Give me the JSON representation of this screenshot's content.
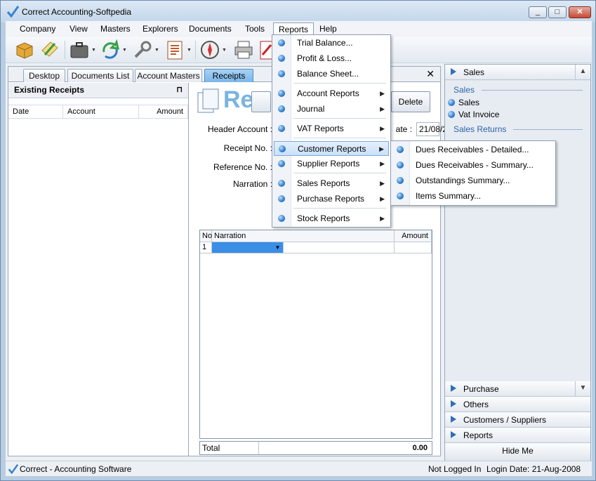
{
  "window": {
    "title": "Correct Accounting-Softpedia",
    "minimize": "_",
    "maximize": "□",
    "close": "✕"
  },
  "menubar": [
    "Company",
    "View",
    "Masters",
    "Explorers",
    "Documents",
    "Tools",
    "Reports",
    "Help"
  ],
  "tabs": {
    "items": [
      "Desktop",
      "Documents List",
      "Account Masters",
      "Receipts"
    ],
    "active": "Receipts",
    "close": "✕"
  },
  "left_pane": {
    "title": "Existing Receipts",
    "pin": "⊓",
    "columns": [
      "Date",
      "Account",
      "Amount"
    ]
  },
  "form": {
    "title": "Re",
    "buttons": {
      "delete": "Delete"
    },
    "labels": {
      "header_account": "Header Account :",
      "receipt_no": "Receipt No. :",
      "reference_no": "Reference No. :",
      "narration": "Narration :",
      "date": "ate :"
    },
    "date_value": "21/08/2",
    "grid": {
      "col_no": "No",
      "col_narration": "Narration",
      "col_amount": "Amount",
      "row1_no": "1"
    },
    "total_label": "Total",
    "total_value": "0.00"
  },
  "right_pane": {
    "top_header": "Sales",
    "section_sales": "Sales",
    "sales_items": [
      "Sales",
      "Vat Invoice"
    ],
    "section_returns": "Sales Returns",
    "bottom_headers": [
      "Purchase",
      "Others",
      "Customers / Suppliers",
      "Reports"
    ],
    "hide": "Hide Me"
  },
  "reports_menu": [
    {
      "label": "Trial Balance...",
      "submenu": false
    },
    {
      "label": "Profit & Loss...",
      "submenu": false
    },
    {
      "label": "Balance Sheet...",
      "submenu": false
    },
    {
      "label": "Account Reports",
      "submenu": true
    },
    {
      "label": "Journal",
      "submenu": true
    },
    {
      "label": "VAT Reports",
      "submenu": true
    },
    {
      "label": "Customer Reports",
      "submenu": true,
      "highlighted": true
    },
    {
      "label": "Supplier Reports",
      "submenu": true
    },
    {
      "label": "Sales Reports",
      "submenu": true
    },
    {
      "label": "Purchase Reports",
      "submenu": true
    },
    {
      "label": "Stock Reports",
      "submenu": true
    }
  ],
  "customer_reports_menu": [
    "Dues Receivables - Detailed...",
    "Dues Receivables - Summary...",
    "Outstandings Summary...",
    "Items Summary..."
  ],
  "status": {
    "app": "Correct - Accounting Software",
    "login": "Not Logged In",
    "date": "Login Date: 21-Aug-2008"
  },
  "colors": {
    "accent": "#2f7ccc",
    "tab_active": "#78b6ea",
    "section_title": "#2c64a8"
  },
  "icons": [
    "box-icon",
    "edit-pencil-icon",
    "briefcase-icon",
    "recycle-icon",
    "tools-icon",
    "report-document-icon",
    "compass-icon",
    "printer-icon",
    "pdf-icon"
  ]
}
